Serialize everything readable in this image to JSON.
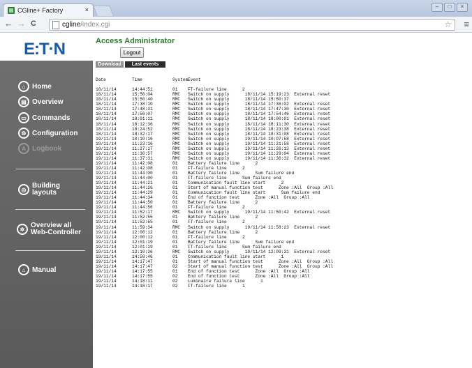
{
  "browser": {
    "tab_title": "CGline+ Factory",
    "tab_close": "×",
    "url_host": "cgline",
    "url_path": "/index.cgi",
    "back": "←",
    "forward": "→",
    "reload": "C",
    "star": "☆",
    "menu": "≡"
  },
  "header": {
    "logo": "E:T·N",
    "user_title": "Access Administrator",
    "logout_label": "Logout"
  },
  "sidebar": {
    "items": [
      {
        "label": "Home",
        "icon": "home-icon"
      },
      {
        "label": "Overview",
        "icon": "overview-icon"
      },
      {
        "label": "Commands",
        "icon": "commands-icon"
      },
      {
        "label": "Configuration",
        "icon": "configuration-icon"
      },
      {
        "label": "Logbook",
        "icon": "logbook-icon"
      },
      {
        "label": "Building layouts",
        "icon": "building-icon"
      },
      {
        "label": "Overview all Web-Controller",
        "icon": "network-icon"
      },
      {
        "label": "Manual",
        "icon": "manual-icon"
      }
    ]
  },
  "content": {
    "tabs": [
      "Download",
      "Last events"
    ],
    "columns": [
      "Date",
      "Time",
      "System",
      "Event"
    ],
    "rows": [
      [
        "18/11/14",
        "14:44:51",
        "01",
        "FT-failure line      2"
      ],
      [
        "18/11/14",
        "15:50:04",
        "RMC",
        "Switch on supply      18/11/14 15:19:23  External reset"
      ],
      [
        "18/11/14",
        "15:50:40",
        "RMC",
        "Switch on supply      18/11/14 15:50:37"
      ],
      [
        "18/11/14",
        "17:38:10",
        "RMC",
        "Switch on supply      18/11/14 17:36:02  External reset"
      ],
      [
        "18/11/14",
        "17:48:31",
        "RMC",
        "Switch on supply      18/11/14 17:47:30  External reset"
      ],
      [
        "18/11/14",
        "17:56:07",
        "RMC",
        "Switch on supply      18/11/14 17:54:46  External reset"
      ],
      [
        "18/11/14",
        "18:01:11",
        "RMC",
        "Switch on supply      18/11/14 18:00:01  External reset"
      ],
      [
        "18/11/14",
        "18:12:36",
        "RMC",
        "Switch on supply      18/11/14 18:11:30  External reset"
      ],
      [
        "18/11/14",
        "18:24:52",
        "RMC",
        "Switch on supply      18/11/14 18:23:38  External reset"
      ],
      [
        "18/11/14",
        "18:32:17",
        "RMC",
        "Switch on supply      18/11/14 18:31:08  External reset"
      ],
      [
        "19/11/14",
        "10:10:16",
        "RMC",
        "Switch on supply      19/11/14 10:07:58  External reset"
      ],
      [
        "19/11/14",
        "11:23:16",
        "RMC",
        "Switch on supply      19/11/14 11:21:58  External reset"
      ],
      [
        "19/11/14",
        "11:27:17",
        "RMC",
        "Switch on supply      19/11/14 11:26:13  External reset"
      ],
      [
        "19/11/14",
        "11:30:57",
        "RMC",
        "Switch on supply      19/11/14 11:29:04  External reset"
      ],
      [
        "19/11/14",
        "11:37:31",
        "RMC",
        "Switch on supply      19/11/14 11:36:32  External reset"
      ],
      [
        "19/11/14",
        "11:42:08",
        "01",
        "Battery failure line      2"
      ],
      [
        "19/11/14",
        "11:42:08",
        "01",
        "FT-failure line      2"
      ],
      [
        "19/11/14",
        "11:44:00",
        "01",
        "Battery failure line      Sum failure end"
      ],
      [
        "19/11/14",
        "11:44:00",
        "01",
        "FT-failure line      Sum failure end"
      ],
      [
        "19/11/14",
        "11:44:21",
        "01",
        "Communication fault line start      2"
      ],
      [
        "19/11/14",
        "11:44:26",
        "01",
        "Start of manual function test      Zone :All  Group :All"
      ],
      [
        "19/11/14",
        "11:44:29",
        "01",
        "Communication fault line start      Sum failure end"
      ],
      [
        "19/11/14",
        "11:44:34",
        "01",
        "End of function test      Zone :All  Group :All"
      ],
      [
        "19/11/14",
        "11:44:50",
        "01",
        "Battery failure line      2"
      ],
      [
        "19/11/14",
        "11:44:56",
        "01",
        "FT-failure line      2"
      ],
      [
        "19/11/14",
        "11:52:17",
        "RMC",
        "Switch on supply      19/11/14 11:50:42  External reset"
      ],
      [
        "19/11/14",
        "11:52:55",
        "01",
        "Battery failure line      2"
      ],
      [
        "19/11/14",
        "11:52:55",
        "01",
        "FT-failure line      2"
      ],
      [
        "19/11/14",
        "11:59:34",
        "RMC",
        "Switch on supply      19/11/14 11:58:23  External reset"
      ],
      [
        "19/11/14",
        "12:00:12",
        "01",
        "Battery failure line      2"
      ],
      [
        "19/11/14",
        "12:00:12",
        "01",
        "FT-failure line      2"
      ],
      [
        "19/11/14",
        "12:01:19",
        "01",
        "Battery failure line      Sum failure end"
      ],
      [
        "19/11/14",
        "12:01:19",
        "01",
        "FT-failure line      Sum failure end"
      ],
      [
        "19/11/14",
        "12:10:36",
        "RMC",
        "Switch on supply      19/11/14 12:09:31  External reset"
      ],
      [
        "19/11/14",
        "14:58:46",
        "01",
        "Communication fault line start      1"
      ],
      [
        "19/11/14",
        "14:17:47",
        "01",
        "Start of manual function test      Zone :All  Group :All"
      ],
      [
        "19/11/14",
        "14:17:47",
        "02",
        "Start of manual function test      Zone :All  Group :All"
      ],
      [
        "19/11/14",
        "14:17:55",
        "01",
        "End of function test      Zone :All  Group :All"
      ],
      [
        "19/11/14",
        "14:17:55",
        "02",
        "End of function test      Zone :All  Group :All"
      ],
      [
        "19/11/14",
        "14:18:11",
        "02",
        "Luminaire failure line      1"
      ],
      [
        "19/11/14",
        "14:18:17",
        "02",
        "FT-failure line      1"
      ]
    ]
  }
}
